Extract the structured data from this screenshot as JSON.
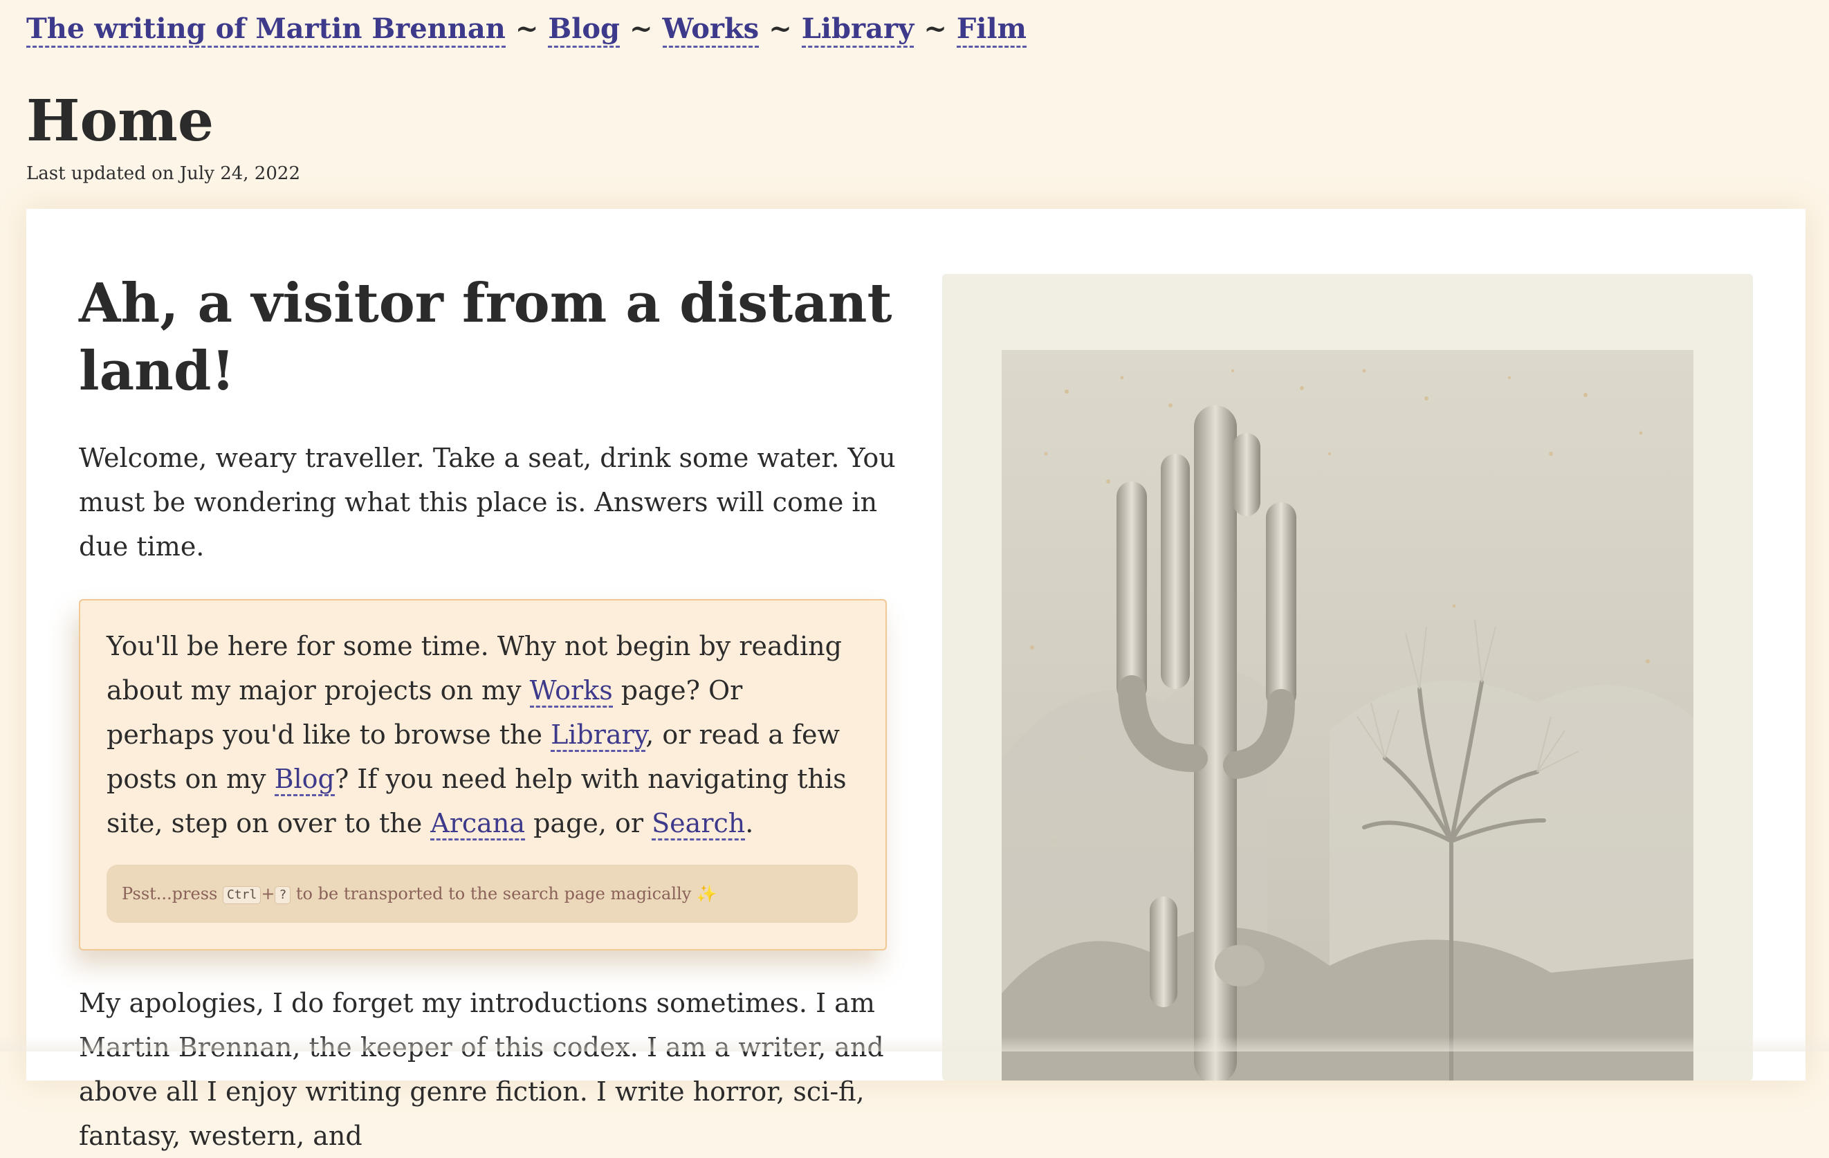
{
  "nav": {
    "site_title": "The writing of Martin Brennan",
    "separator": "~",
    "items": [
      {
        "label": "Blog"
      },
      {
        "label": "Works"
      },
      {
        "label": "Library"
      },
      {
        "label": "Film"
      }
    ]
  },
  "page": {
    "title": "Home",
    "last_updated": "Last updated on July 24, 2022"
  },
  "content": {
    "heading": "Ah, a visitor from a distant land!",
    "intro": "Welcome, weary traveller. Take a seat, drink some water. You must be wondering what this place is. Answers will come in due time.",
    "callout": {
      "text_1": "You'll be here for some time. Why not begin by reading about my major projects on my ",
      "link_works": "Works",
      "text_2": " page? Or perhaps you'd like to browse the ",
      "link_library": "Library",
      "text_3": ", or read a few posts on my ",
      "link_blog": "Blog",
      "text_4": "? If you need help with navigating this site, step on over to the ",
      "link_arcana": "Arcana",
      "text_5": " page, or ",
      "link_search": "Search",
      "text_6": ".",
      "tip": {
        "prefix": "Psst...press ",
        "key_1": "Ctrl",
        "plus": "+",
        "key_2": "?",
        "suffix": " to be transported to the search page magically ",
        "sparkle": "✨"
      }
    },
    "outro": "My apologies, I do forget my introductions sometimes. I am Martin Brennan, the keeper of this codex. I am a writer, and above all I enjoy writing genre fiction. I write horror, sci-fi, fantasy, western, and"
  },
  "image": {
    "icon": "cactus-illustration-icon"
  }
}
